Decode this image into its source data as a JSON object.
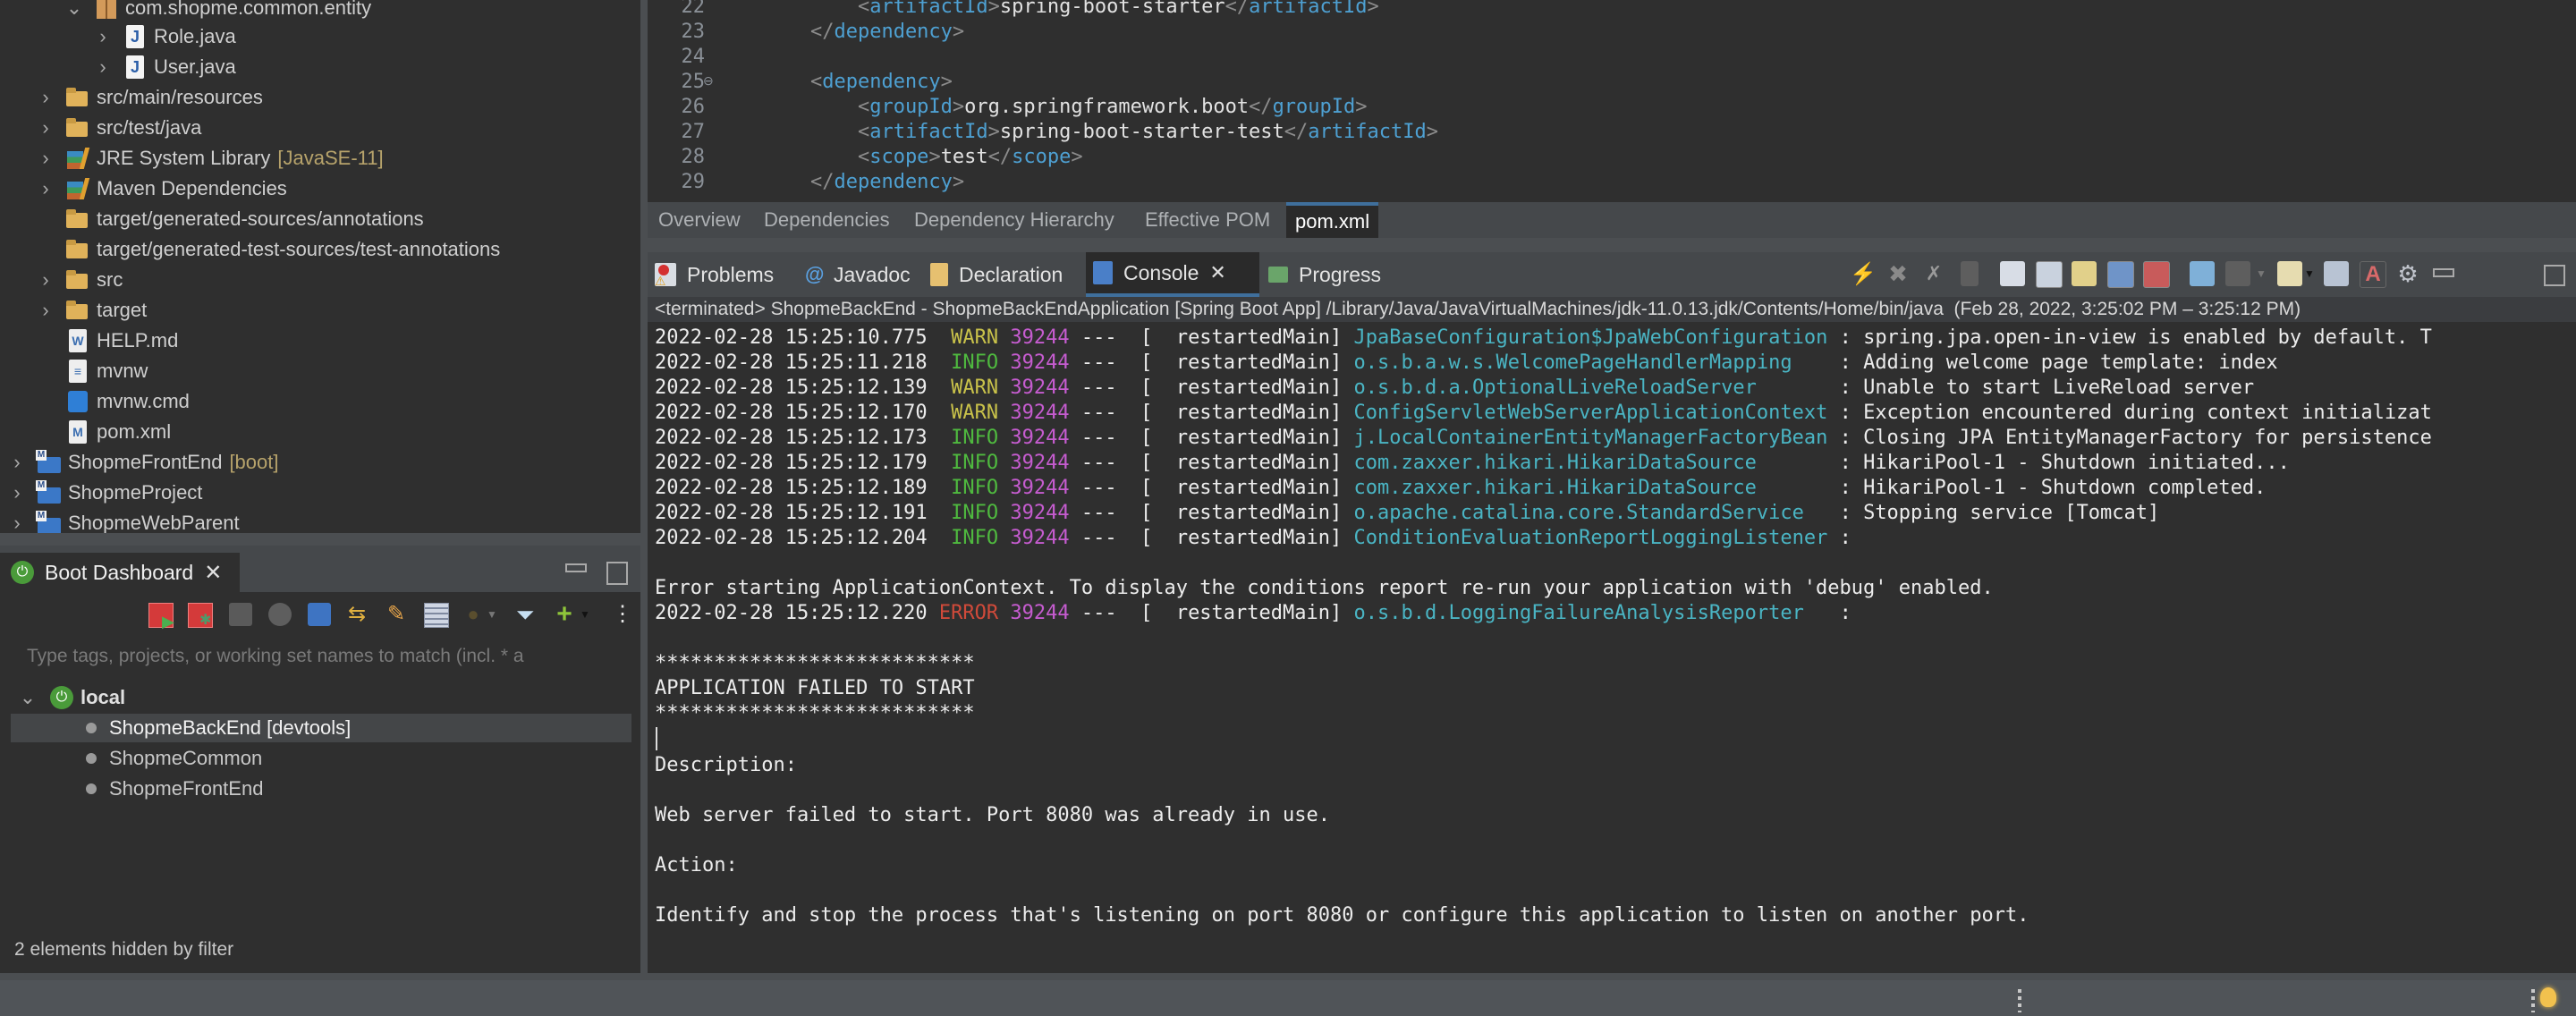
{
  "explorer": {
    "items": [
      {
        "label": "com.shopme.common.entity",
        "icon": "package-icon",
        "expanded": true
      },
      {
        "label": "Role.java",
        "icon": "java-file-icon"
      },
      {
        "label": "User.java",
        "icon": "java-file-icon"
      },
      {
        "label": "src/main/resources",
        "icon": "source-folder-icon"
      },
      {
        "label": "src/test/java",
        "icon": "source-folder-icon"
      },
      {
        "label": "JRE System Library",
        "decoration": "[JavaSE-11]",
        "icon": "library-icon"
      },
      {
        "label": "Maven Dependencies",
        "icon": "library-icon"
      },
      {
        "label": "target/generated-sources/annotations",
        "icon": "source-folder-icon"
      },
      {
        "label": "target/generated-test-sources/test-annotations",
        "icon": "source-folder-icon"
      },
      {
        "label": "src",
        "icon": "folder-icon"
      },
      {
        "label": "target",
        "icon": "folder-icon"
      },
      {
        "label": "HELP.md",
        "icon": "markdown-file-icon"
      },
      {
        "label": "mvnw",
        "icon": "text-file-icon"
      },
      {
        "label": "mvnw.cmd",
        "icon": "cmd-file-icon"
      },
      {
        "label": "pom.xml",
        "icon": "maven-file-icon"
      },
      {
        "label": "ShopmeFrontEnd",
        "decoration": "[boot]",
        "icon": "maven-project-icon"
      },
      {
        "label": "ShopmeProject",
        "icon": "maven-project-icon"
      },
      {
        "label": "ShopmeWebParent",
        "icon": "maven-project-icon"
      }
    ]
  },
  "boot_dashboard": {
    "tab_label": "Boot Dashboard",
    "filter_placeholder": "Type tags, projects, or working set names to match (incl. * a",
    "group": "local",
    "apps": [
      {
        "label": "ShopmeBackEnd [devtools]",
        "selected": true
      },
      {
        "label": "ShopmeCommon"
      },
      {
        "label": "ShopmeFrontEnd"
      }
    ],
    "footer": "2 elements hidden by filter"
  },
  "editor": {
    "lines": [
      {
        "n": "22",
        "indent": "            ",
        "tag": "artifactId",
        "text": "spring-boot-starter",
        "close": true
      },
      {
        "n": "23",
        "indent": "        ",
        "closing_tag": "dependency"
      },
      {
        "n": "24"
      },
      {
        "n": "25",
        "indent": "        ",
        "open_tag": "dependency",
        "fold": true
      },
      {
        "n": "26",
        "indent": "            ",
        "tag": "groupId",
        "text": "org.springframework.boot",
        "close": true
      },
      {
        "n": "27",
        "indent": "            ",
        "tag": "artifactId",
        "text": "spring-boot-starter-test",
        "close": true
      },
      {
        "n": "28",
        "indent": "            ",
        "tag": "scope",
        "text": "test",
        "close": true
      },
      {
        "n": "29",
        "indent": "        ",
        "closing_tag": "dependency"
      }
    ],
    "tabs": [
      "Overview",
      "Dependencies",
      "Dependency Hierarchy",
      "Effective POM",
      "pom.xml"
    ],
    "active_tab": "pom.xml"
  },
  "views": {
    "tabs": [
      {
        "label": "Problems",
        "icon": "problems-icon"
      },
      {
        "label": "Javadoc",
        "icon": "javadoc-icon"
      },
      {
        "label": "Declaration",
        "icon": "declaration-icon"
      },
      {
        "label": "Console",
        "icon": "console-icon",
        "active": true
      },
      {
        "label": "Progress",
        "icon": "progress-icon"
      }
    ]
  },
  "console": {
    "header": "<terminated> ShopmeBackEnd - ShopmeBackEndApplication [Spring Boot App] /Library/Java/JavaVirtualMachines/jdk-11.0.13.jdk/Contents/Home/bin/java  (Feb 28, 2022, 3:25:02 PM – 3:25:12 PM)",
    "log": [
      {
        "ts": "2022-02-28 15:25:10.775",
        "level": "WARN",
        "pid": "39244",
        "thread": "---  [  restartedMain]",
        "logger": "JpaBaseConfiguration$JpaWebConfiguration",
        "msg": ": spring.jpa.open-in-view is enabled by default. T"
      },
      {
        "ts": "2022-02-28 15:25:11.218",
        "level": "INFO",
        "pid": "39244",
        "thread": "---  [  restartedMain]",
        "logger": "o.s.b.a.w.s.WelcomePageHandlerMapping   ",
        "msg": ": Adding welcome page template: index"
      },
      {
        "ts": "2022-02-28 15:25:12.139",
        "level": "WARN",
        "pid": "39244",
        "thread": "---  [  restartedMain]",
        "logger": "o.s.b.d.a.OptionalLiveReloadServer      ",
        "msg": ": Unable to start LiveReload server"
      },
      {
        "ts": "2022-02-28 15:25:12.170",
        "level": "WARN",
        "pid": "39244",
        "thread": "---  [  restartedMain]",
        "logger": "ConfigServletWebServerApplicationContext",
        "msg": ": Exception encountered during context initializat"
      },
      {
        "ts": "2022-02-28 15:25:12.173",
        "level": "INFO",
        "pid": "39244",
        "thread": "---  [  restartedMain]",
        "logger": "j.LocalContainerEntityManagerFactoryBean",
        "msg": ": Closing JPA EntityManagerFactory for persistence"
      },
      {
        "ts": "2022-02-28 15:25:12.179",
        "level": "INFO",
        "pid": "39244",
        "thread": "---  [  restartedMain]",
        "logger": "com.zaxxer.hikari.HikariDataSource      ",
        "msg": ": HikariPool-1 - Shutdown initiated..."
      },
      {
        "ts": "2022-02-28 15:25:12.189",
        "level": "INFO",
        "pid": "39244",
        "thread": "---  [  restartedMain]",
        "logger": "com.zaxxer.hikari.HikariDataSource      ",
        "msg": ": HikariPool-1 - Shutdown completed."
      },
      {
        "ts": "2022-02-28 15:25:12.191",
        "level": "INFO",
        "pid": "39244",
        "thread": "---  [  restartedMain]",
        "logger": "o.apache.catalina.core.StandardService  ",
        "msg": ": Stopping service [Tomcat]"
      },
      {
        "ts": "2022-02-28 15:25:12.204",
        "level": "INFO",
        "pid": "39244",
        "thread": "---  [  restartedMain]",
        "logger": "ConditionEvaluationReportLoggingListener",
        "msg": ":"
      }
    ],
    "error_context": "Error starting ApplicationContext. To display the conditions report re-run your application with 'debug' enabled.",
    "error_line": {
      "ts": "2022-02-28 15:25:12.220",
      "level": "ERROR",
      "pid": "39244",
      "thread": "---  [  restartedMain]",
      "logger": "o.s.b.d.LoggingFailureAnalysisReporter  ",
      "msg": ":"
    },
    "stars": "***************************",
    "failed_title": "APPLICATION FAILED TO START",
    "description_label": "Description:",
    "description": "Web server failed to start. Port 8080 was already in use.",
    "action_label": "Action:",
    "action": "Identify and stop the process that's listening on port 8080 or configure this application to listen on another port."
  },
  "colors": {
    "warn": "#c9c24a",
    "info": "#4fba3f",
    "error": "#d04a3a",
    "pid": "#c65cd0",
    "logger": "#4ab5c4",
    "xml_tag": "#4ea0d2",
    "accent": "#3f6f9c"
  }
}
